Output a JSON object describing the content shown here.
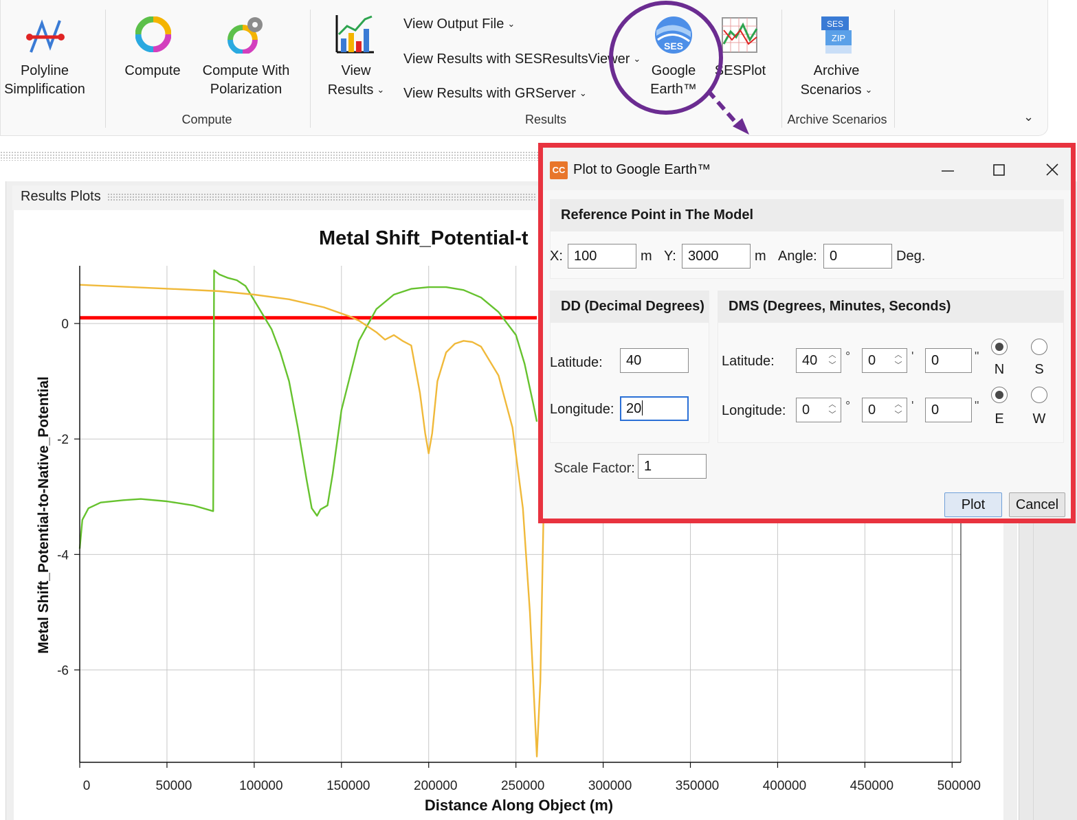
{
  "ribbon": {
    "buttons": {
      "polyline": "Polyline\nSimplification",
      "compute": "Compute",
      "compute_polar": "Compute With\nPolarization",
      "view_results": "View\nResults",
      "google_earth": "Google\nEarth™",
      "sesplot": "SESPlot",
      "archive": "Archive\nScenarios"
    },
    "menus": {
      "view_output": "View Output File",
      "view_ses": "View Results with SESResultsViewer",
      "view_gr": "View Results with GRServer"
    },
    "groups": {
      "compute": "Compute",
      "results": "Results",
      "archive": "Archive Scenarios"
    },
    "icons": {
      "polyline": "polyline-simplification-icon",
      "compute": "compute-cycle-icon",
      "compute_polar": "compute-polarization-icon",
      "view_results": "bar-line-chart-icon",
      "google_earth": "google-earth-icon",
      "sesplot": "sesplot-icon",
      "archive": "zip-archive-icon",
      "sesplot_icon_text": "SES",
      "archive_icon_text": "ZIP",
      "ge_icon_text": "SES"
    }
  },
  "panel": {
    "tab_label": "Results Plots"
  },
  "chart_data": {
    "type": "line",
    "title": "Metal Shift_Potential-t",
    "xlabel": "Distance Along Object (m)",
    "ylabel": "Metal Shift_Potential-to-Native_Potential",
    "xlim": [
      0,
      505000
    ],
    "ylim": [
      -7.6,
      1.0
    ],
    "x_ticks": [
      0,
      50000,
      100000,
      150000,
      200000,
      250000,
      300000,
      350000,
      400000,
      450000,
      500000
    ],
    "y_ticks": [
      0,
      -2,
      -4,
      -6
    ],
    "grid": true,
    "series": [
      {
        "color": "#ff0000",
        "x": [
          0,
          262000
        ],
        "y": [
          0.1,
          0.1
        ]
      },
      {
        "color": "#66c22e",
        "x": [
          0,
          1500,
          5000,
          12000,
          25000,
          35000,
          50000,
          65000,
          76500,
          77000,
          80000,
          85000,
          90000,
          95000,
          100000,
          105000,
          110000,
          115000,
          120000,
          125000,
          130000,
          133000,
          136000,
          138000,
          142000,
          145000,
          150000,
          160000,
          170000,
          180000,
          190000,
          200000,
          210000,
          220000,
          230000,
          240000,
          250000,
          255000,
          260000,
          262000
        ],
        "y": [
          -3.9,
          -3.4,
          -3.2,
          -3.1,
          -3.06,
          -3.04,
          -3.08,
          -3.15,
          -3.25,
          0.92,
          0.85,
          0.79,
          0.75,
          0.65,
          0.4,
          0.15,
          -0.1,
          -0.5,
          -1.0,
          -1.8,
          -2.7,
          -3.2,
          -3.33,
          -3.22,
          -3.15,
          -2.6,
          -1.5,
          -0.3,
          0.25,
          0.5,
          0.6,
          0.63,
          0.63,
          0.58,
          0.45,
          0.2,
          -0.2,
          -0.7,
          -1.4,
          -1.7
        ]
      },
      {
        "color": "#f0b93a",
        "x": [
          0,
          30000,
          60000,
          80000,
          100000,
          120000,
          140000,
          155000,
          160000,
          165000,
          170000,
          175000,
          180000,
          185000,
          190000,
          195000,
          198000,
          200000,
          202000,
          205000,
          210000,
          215000,
          220000,
          225000,
          230000,
          240000,
          248000,
          254000,
          258000,
          262000,
          264000,
          266000,
          267500
        ],
        "y": [
          0.67,
          0.63,
          0.59,
          0.56,
          0.5,
          0.42,
          0.28,
          0.12,
          0.05,
          -0.05,
          -0.15,
          -0.28,
          -0.2,
          -0.3,
          -0.38,
          -1.2,
          -1.9,
          -2.25,
          -1.9,
          -1.0,
          -0.5,
          -0.35,
          -0.3,
          -0.32,
          -0.4,
          -0.9,
          -1.8,
          -3.2,
          -5.0,
          -7.5,
          -6.2,
          -3.0,
          -1.5
        ]
      }
    ]
  },
  "dialog": {
    "title": "Plot to Google Earth™",
    "icon_text": "CC",
    "icons": {
      "minimize": "minimize-icon",
      "maximize": "maximize-icon",
      "close": "close-icon"
    },
    "reference_header": "Reference Point in The Model",
    "x_label": "X:",
    "x_value": "100",
    "x_unit": "m",
    "y_label": "Y:",
    "y_value": "3000",
    "y_unit": "m",
    "angle_label": "Angle:",
    "angle_value": "0",
    "angle_unit": "Deg.",
    "dd_header": "DD (Decimal Degrees)",
    "dd_lat_label": "Latitude:",
    "dd_lat_value": "40",
    "dd_lon_label": "Longitude:",
    "dd_lon_value": "20",
    "dms_header": "DMS (Degrees, Minutes, Seconds)",
    "dms_lat_label": "Latitude:",
    "dms_lat": {
      "deg": "40",
      "min": "0",
      "sec": "0"
    },
    "dms_lon_label": "Longitude:",
    "dms_lon": {
      "deg": "0",
      "min": "0",
      "sec": "0"
    },
    "deg_symbol": "°",
    "min_symbol": "'",
    "sec_symbol": "\"",
    "hemi": {
      "n": "N",
      "s": "S",
      "e": "E",
      "w": "W",
      "lat_selected": "N",
      "lon_selected": "E"
    },
    "scale_label": "Scale Factor:",
    "scale_value": "1",
    "plot_button": "Plot",
    "cancel_button": "Cancel"
  },
  "colors": {
    "highlight_frame": "#e8333f",
    "annotation": "#6b2c91",
    "green_series": "#66c22e",
    "orange_series": "#f0b93a",
    "red_series": "#ff0000"
  }
}
